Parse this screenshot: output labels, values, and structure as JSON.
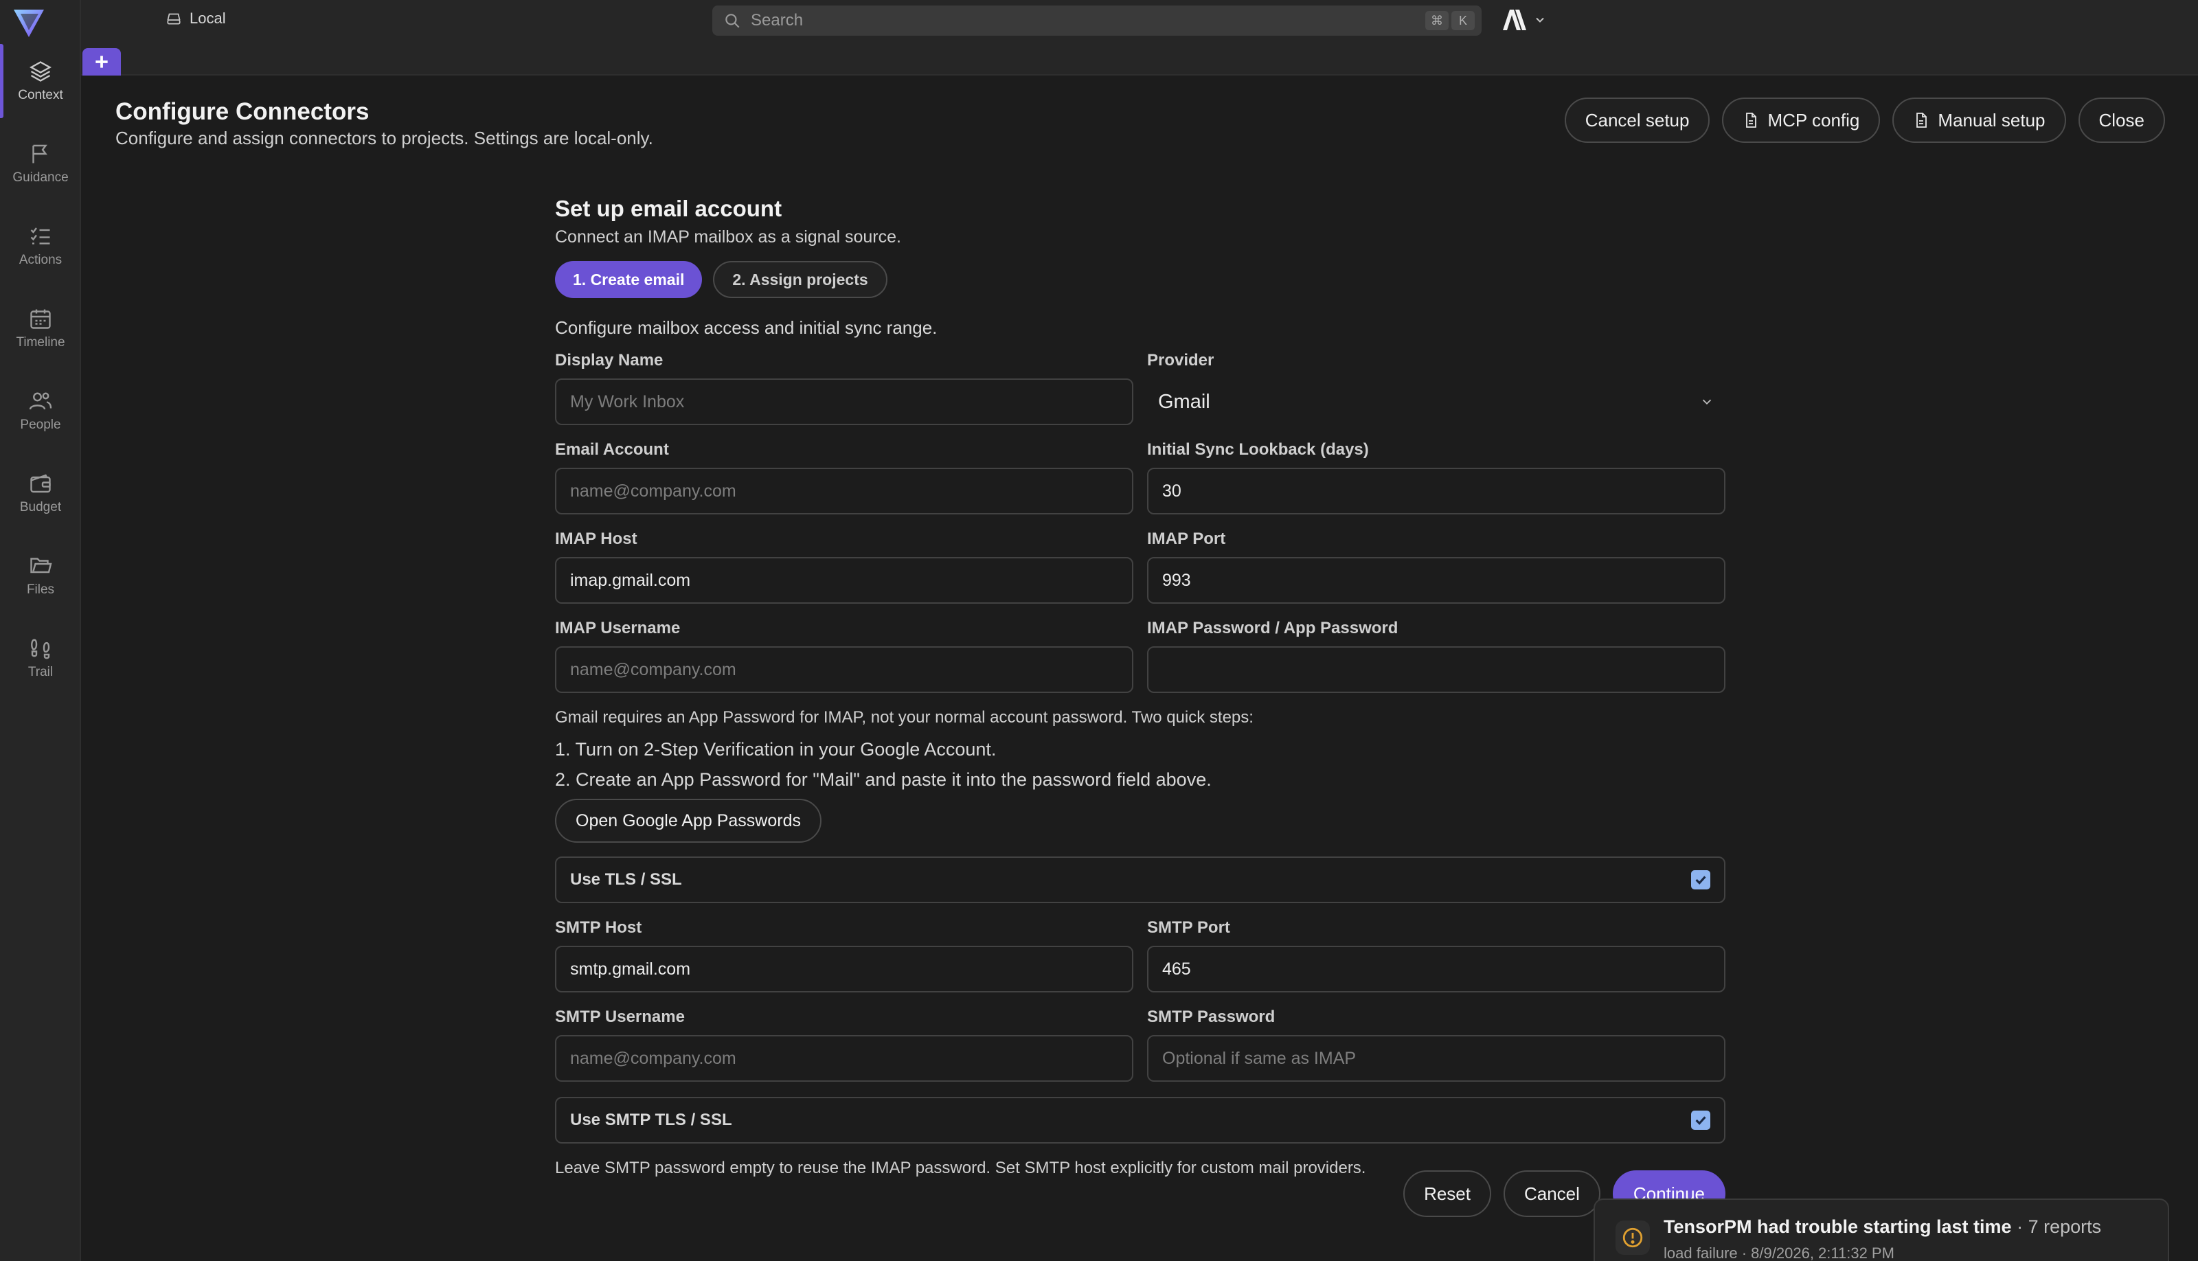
{
  "sidebar": {
    "items": [
      {
        "label": "Context",
        "icon": "layers-icon",
        "active": true
      },
      {
        "label": "Guidance",
        "icon": "flag-icon"
      },
      {
        "label": "Actions",
        "icon": "checklist-icon"
      },
      {
        "label": "Timeline",
        "icon": "calendar-icon"
      },
      {
        "label": "People",
        "icon": "people-icon"
      },
      {
        "label": "Budget",
        "icon": "wallet-icon"
      },
      {
        "label": "Files",
        "icon": "folder-icon"
      },
      {
        "label": "Trail",
        "icon": "footprints-icon"
      }
    ]
  },
  "topbar": {
    "workspace": "Local",
    "search_placeholder": "Search",
    "shortcut_keys": [
      "⌘",
      "K"
    ]
  },
  "header": {
    "title": "Configure Connectors",
    "subtitle": "Configure and assign connectors to projects. Settings are local-only.",
    "buttons": {
      "cancel_setup": "Cancel setup",
      "mcp_config": "MCP config",
      "manual_setup": "Manual setup",
      "close": "Close"
    }
  },
  "form": {
    "title": "Set up email account",
    "subtitle": "Connect an IMAP mailbox as a signal source.",
    "steps": [
      "1. Create email",
      "2. Assign projects"
    ],
    "active_step": 0,
    "description": "Configure mailbox access and initial sync range.",
    "fields": {
      "display_name": {
        "label": "Display Name",
        "value": "",
        "placeholder": "My Work Inbox"
      },
      "provider": {
        "label": "Provider",
        "value": "Gmail"
      },
      "email_account": {
        "label": "Email Account",
        "value": "",
        "placeholder": "name@company.com"
      },
      "sync_lookback": {
        "label": "Initial Sync Lookback (days)",
        "value": "30"
      },
      "imap_host": {
        "label": "IMAP Host",
        "value": "imap.gmail.com"
      },
      "imap_port": {
        "label": "IMAP Port",
        "value": "993"
      },
      "imap_username": {
        "label": "IMAP Username",
        "value": "",
        "placeholder": "name@company.com"
      },
      "imap_password": {
        "label": "IMAP Password / App Password",
        "value": ""
      },
      "smtp_host": {
        "label": "SMTP Host",
        "value": "smtp.gmail.com"
      },
      "smtp_port": {
        "label": "SMTP Port",
        "value": "465"
      },
      "smtp_username": {
        "label": "SMTP Username",
        "value": "",
        "placeholder": "name@company.com"
      },
      "smtp_password": {
        "label": "SMTP Password",
        "value": "",
        "placeholder": "Optional if same as IMAP"
      }
    },
    "gmail_help": {
      "intro": "Gmail requires an App Password for IMAP, not your normal account password. Two quick steps:",
      "step1": "1. Turn on 2-Step Verification in your Google Account.",
      "step2": "2. Create an App Password for \"Mail\" and paste it into the password field above.",
      "button": "Open Google App Passwords"
    },
    "use_tls": {
      "label": "Use TLS / SSL",
      "checked": true
    },
    "use_smtp_tls": {
      "label": "Use SMTP TLS / SSL",
      "checked": true
    },
    "footnote": "Leave SMTP password empty to reuse the IMAP password. Set SMTP host explicitly for custom mail providers.",
    "actions": {
      "reset": "Reset",
      "cancel": "Cancel",
      "continue": "Continue"
    }
  },
  "toast": {
    "title": "TensorPM had trouble starting last time",
    "count": "· 7 reports",
    "detail": "load failure · 8/9/2026, 2:11:32 PM"
  },
  "colors": {
    "accent": "#6b52d4",
    "checkbox": "#8db4f0",
    "warning": "#e0a030"
  }
}
